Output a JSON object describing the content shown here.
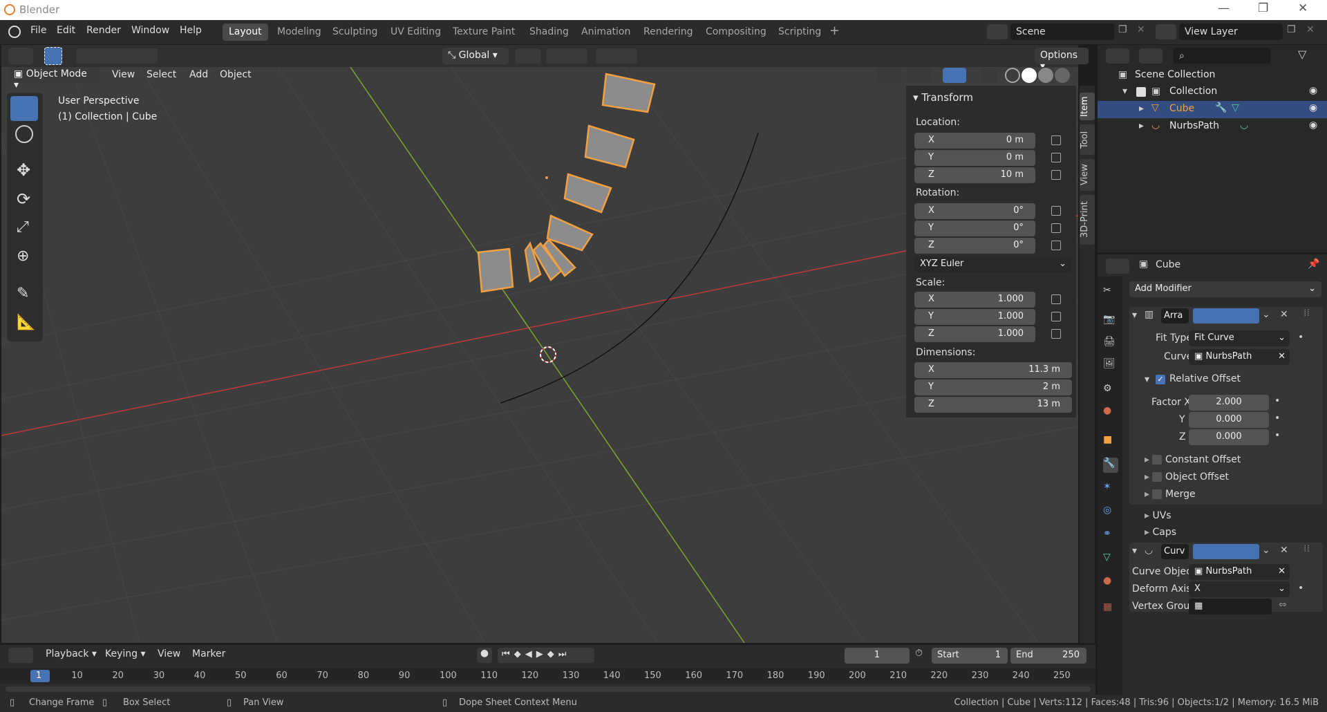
{
  "app": {
    "title": "Blender"
  },
  "menu": [
    "File",
    "Edit",
    "Render",
    "Window",
    "Help"
  ],
  "workspaces": [
    "Layout",
    "Modeling",
    "Sculpting",
    "UV Editing",
    "Texture Paint",
    "Shading",
    "Animation",
    "Rendering",
    "Compositing",
    "Scripting"
  ],
  "scene": {
    "name": "Scene",
    "view_layer": "View Layer"
  },
  "header": {
    "orientation": "Global",
    "options": "Options"
  },
  "viewport_menu": {
    "mode": "Object Mode",
    "items": [
      "View",
      "Select",
      "Add",
      "Object"
    ]
  },
  "viewport_info": {
    "line1": "User Perspective",
    "line2": "(1) Collection | Cube"
  },
  "transform": {
    "title": "Transform",
    "location_label": "Location:",
    "location": [
      {
        "axis": "X",
        "value": "0 m"
      },
      {
        "axis": "Y",
        "value": "0 m"
      },
      {
        "axis": "Z",
        "value": "10 m"
      }
    ],
    "rotation_label": "Rotation:",
    "rotation": [
      {
        "axis": "X",
        "value": "0°"
      },
      {
        "axis": "Y",
        "value": "0°"
      },
      {
        "axis": "Z",
        "value": "0°"
      }
    ],
    "rotation_mode": "XYZ Euler",
    "scale_label": "Scale:",
    "scale": [
      {
        "axis": "X",
        "value": "1.000"
      },
      {
        "axis": "Y",
        "value": "1.000"
      },
      {
        "axis": "Z",
        "value": "1.000"
      }
    ],
    "dimensions_label": "Dimensions:",
    "dimensions": [
      {
        "axis": "X",
        "value": "11.3 m"
      },
      {
        "axis": "Y",
        "value": "2 m"
      },
      {
        "axis": "Z",
        "value": "13 m"
      }
    ]
  },
  "ntabs": [
    "Item",
    "Tool",
    "View",
    "3D-Print"
  ],
  "outliner": {
    "scene_collection": "Scene Collection",
    "collection": "Collection",
    "items": [
      "Cube",
      "NurbsPath"
    ]
  },
  "properties": {
    "object_name": "Cube",
    "add_modifier": "Add Modifier",
    "array": {
      "name": "Arra",
      "fit_type_label": "Fit Type",
      "fit_type": "Fit Curve",
      "curve_label": "Curve",
      "curve": "NurbsPath",
      "relative_offset": "Relative Offset",
      "factor_x_label": "Factor X",
      "factor_x": "2.000",
      "y_label": "Y",
      "factor_y": "0.000",
      "z_label": "Z",
      "factor_z": "0.000",
      "constant_offset": "Constant Offset",
      "object_offset": "Object Offset",
      "merge": "Merge",
      "uvs": "UVs",
      "caps": "Caps"
    },
    "curve_mod": {
      "name": "Curv",
      "curve_object_label": "Curve Object",
      "curve_object": "NurbsPath",
      "deform_axis_label": "Deform Axis",
      "deform_axis": "X",
      "vertex_group_label": "Vertex Group"
    }
  },
  "timeline": {
    "menus": [
      "Playback",
      "Keying",
      "View",
      "Marker"
    ],
    "current": "1",
    "start_label": "Start",
    "start": "1",
    "end_label": "End",
    "end": "250",
    "ruler": [
      "1",
      "10",
      "20",
      "30",
      "40",
      "50",
      "60",
      "70",
      "80",
      "90",
      "100",
      "110",
      "120",
      "130",
      "140",
      "150",
      "160",
      "170",
      "180",
      "190",
      "200",
      "210",
      "220",
      "230",
      "240",
      "250"
    ]
  },
  "status": {
    "left": [
      "Change Frame",
      "Box Select",
      "Pan View",
      "Dope Sheet Context Menu"
    ],
    "right": "Collection | Cube | Verts:112 | Faces:48 | Tris:96 | Objects:1/2 | Memory: 16.5 MiB"
  },
  "colors": {
    "accent": "#4772b3",
    "selected": "#f5a040",
    "axis_x": "#c0393b",
    "axis_y": "#7aa82b",
    "annotation": "#e02020"
  }
}
